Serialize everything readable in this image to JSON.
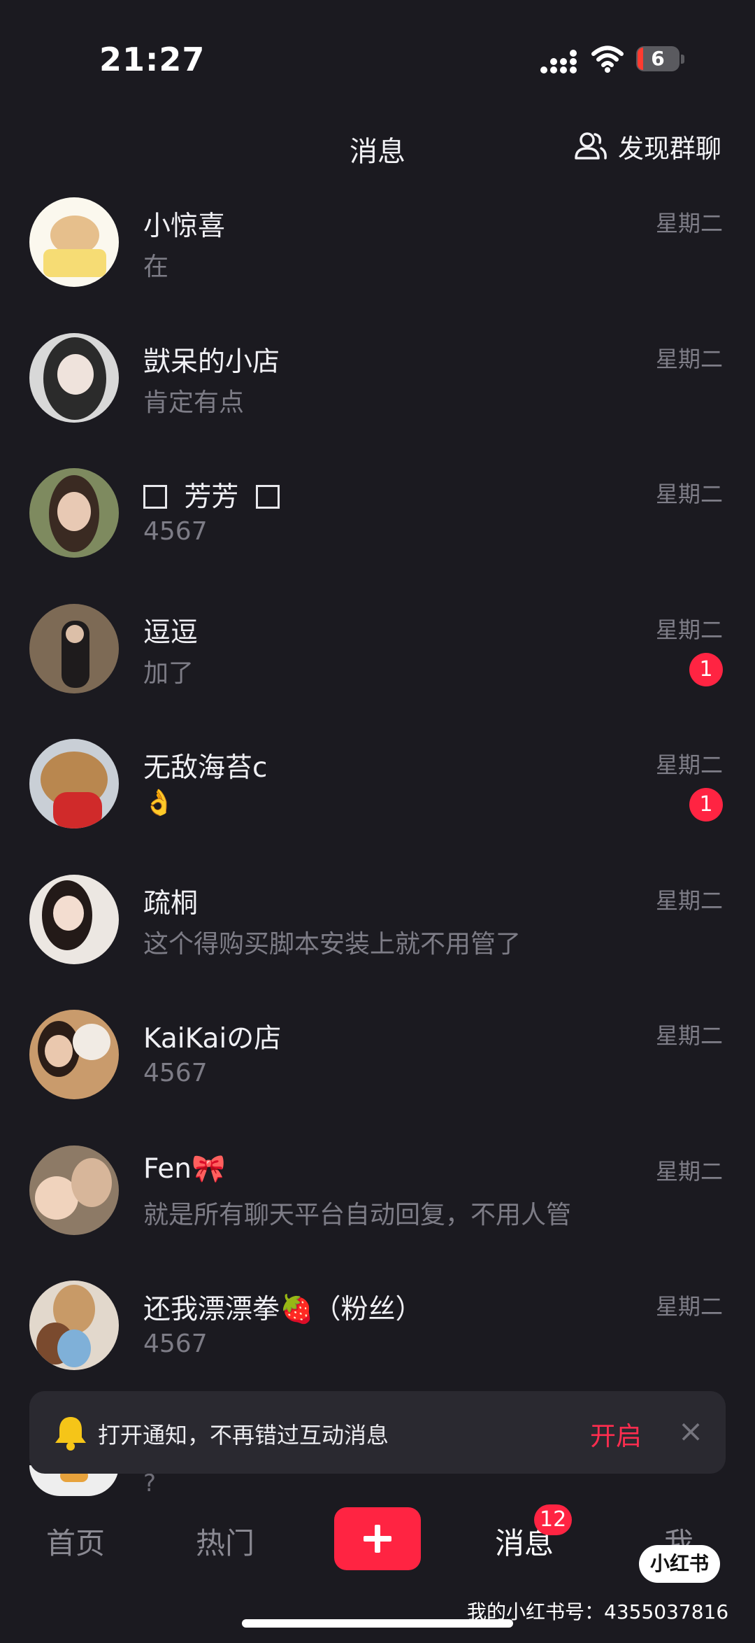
{
  "status_bar": {
    "time": "21:27",
    "battery": "6"
  },
  "header": {
    "title": "消息",
    "discover_label": "发现群聊"
  },
  "conversations": [
    {
      "name": "小惊喜",
      "preview": "在",
      "day": "星期二",
      "unread": ""
    },
    {
      "name": "獃呆的小店",
      "preview": "肯定有点",
      "day": "星期二",
      "unread": ""
    },
    {
      "name": "芳芳",
      "preview": "4567",
      "day": "星期二",
      "unread": ""
    },
    {
      "name": "逗逗",
      "preview": "加了",
      "day": "星期二",
      "unread": "1"
    },
    {
      "name": "无敌海苔c",
      "preview": "👌",
      "day": "星期二",
      "unread": "1"
    },
    {
      "name": "疏桐",
      "preview": "这个得购买脚本安装上就不用管了",
      "day": "星期二",
      "unread": ""
    },
    {
      "name": "KaiKaiの店",
      "preview": "4567",
      "day": "星期二",
      "unread": ""
    },
    {
      "name": "Fen🎀",
      "preview": "就是所有聊天平台自动回复，不用人管",
      "day": "星期二",
      "unread": ""
    },
    {
      "name": "还我漂漂拳🍓（粉丝）",
      "preview": "4567",
      "day": "星期二",
      "unread": ""
    }
  ],
  "partial_row": {
    "preview": "?"
  },
  "notice": {
    "text": "打开通知，不再错过互动消息",
    "action": "开启",
    "close": "×"
  },
  "tabbar": {
    "home": "首页",
    "hot": "热门",
    "messages": "消息",
    "me": "我",
    "messages_badge": "12"
  },
  "branding": {
    "logo": "小红书",
    "watermark": "我的小红书号：4355037816"
  },
  "colors": {
    "accent": "#ff2442",
    "background": "#1b1a20"
  }
}
